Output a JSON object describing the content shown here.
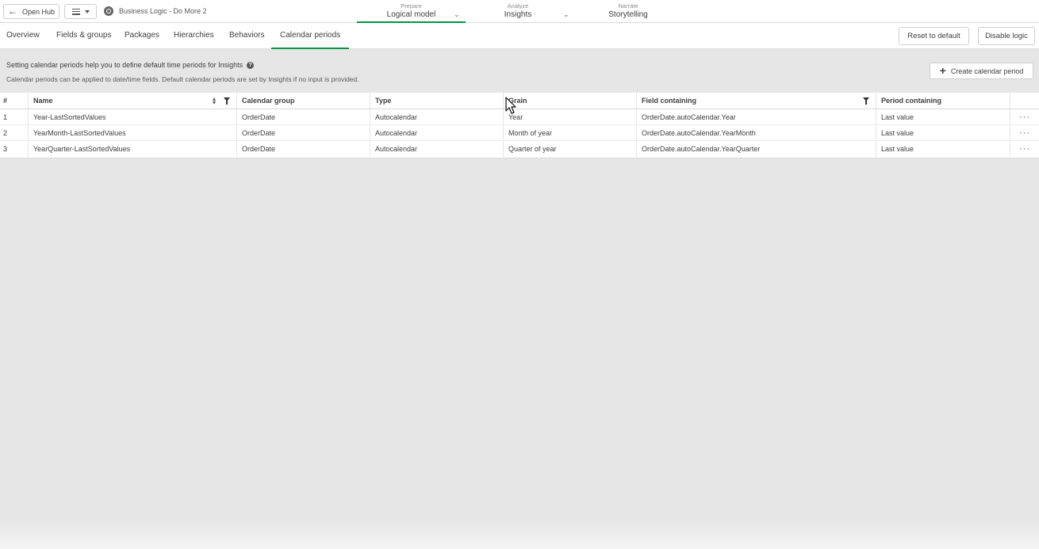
{
  "topbar": {
    "open_hub": "Open Hub",
    "app_title": "Business Logic - Do More 2",
    "stages": [
      {
        "small": "Prepare",
        "big": "Logical model"
      },
      {
        "small": "Analyze",
        "big": "Insights"
      },
      {
        "small": "Narrate",
        "big": "Storytelling"
      }
    ]
  },
  "tabs": [
    "Overview",
    "Fields & groups",
    "Packages",
    "Hierarchies",
    "Behaviors",
    "Calendar periods"
  ],
  "actions": {
    "reset": "Reset to default",
    "disable": "Disable logic",
    "create": "Create calendar period"
  },
  "info": {
    "title": "Setting calendar periods help you to define default time periods for Insights",
    "subtitle": "Calendar periods can be applied to date/time fields. Default calendar periods are set by Insights if no input is provided."
  },
  "table": {
    "headers": [
      "#",
      "Name",
      "Calendar group",
      "Type",
      "Grain",
      "Field containing",
      "Period containing"
    ],
    "rows": [
      [
        "1",
        "Year-LastSortedValues",
        "OrderDate",
        "Autocalendar",
        "Year",
        "OrderDate.autoCalendar.Year",
        "Last value"
      ],
      [
        "2",
        "YearMonth-LastSortedValues",
        "OrderDate",
        "Autocalendar",
        "Month of year",
        "OrderDate.autoCalendar.YearMonth",
        "Last value"
      ],
      [
        "3",
        "YearQuarter-LastSortedValues",
        "OrderDate",
        "Autocalendar",
        "Quarter of year",
        "OrderDate.autoCalendar.YearQuarter",
        "Last value"
      ]
    ],
    "row_menu": "···"
  },
  "colors": {
    "accent": "#009845",
    "background": "#e6e6e6"
  },
  "icons": [
    "back-arrow-icon",
    "hamburger-icon",
    "app-icon",
    "chevron-down-icon",
    "help-icon",
    "plus-icon",
    "sort-icon",
    "filter-icon",
    "more-icon",
    "mouse-cursor-icon"
  ]
}
